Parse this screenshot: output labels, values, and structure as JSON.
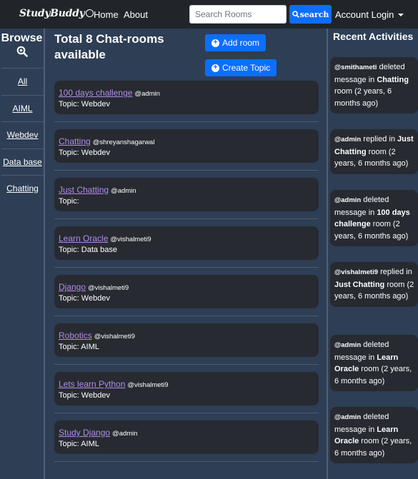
{
  "navbar": {
    "brand": "StudyBuddy",
    "home": "Home",
    "about": "About",
    "search_placeholder": "Search Rooms",
    "search_button": "search",
    "account": "Account Login"
  },
  "browse": {
    "title": "Browse",
    "topics": [
      "All",
      "AIML",
      "Webdev",
      "Data base",
      "Chatting"
    ]
  },
  "main": {
    "title": "Total 8 Chat-rooms available",
    "add_room": "Add room",
    "create_topic": "Create Topic",
    "rooms": [
      {
        "name": "100 days challenge",
        "host": "@admin",
        "topic": "Topic: Webdev"
      },
      {
        "name": "Chatting",
        "host": "@shreyanshagarwal",
        "topic": "Topic: Webdev"
      },
      {
        "name": "Just Chatting",
        "host": "@admin",
        "topic": "Topic:"
      },
      {
        "name": "Learn Oracle",
        "host": "@vishalmeti9",
        "topic": "Topic: Data base"
      },
      {
        "name": "Django",
        "host": "@vishalmeti9",
        "topic": "Topic: Webdev"
      },
      {
        "name": "Robotics",
        "host": "@vishalmeti9",
        "topic": "Topic: AIML"
      },
      {
        "name": "Lets learn Python",
        "host": "@vishalmeti9",
        "topic": "Topic: Webdev"
      },
      {
        "name": "Study Django",
        "host": "@admin",
        "topic": "Topic: AIML"
      }
    ]
  },
  "activities": {
    "title": "Recent Activities",
    "items": [
      {
        "user": "@smithameti",
        "action": " deleted message in ",
        "room": "Chatting",
        "suffix": " room (2 years, 6 months ago)"
      },
      {
        "user": "@admin",
        "action": " replied in ",
        "room": "Just Chatting",
        "suffix": " room (2 years, 6 months ago)"
      },
      {
        "user": "@admin",
        "action": " deleted message in ",
        "room": "100 days challenge",
        "suffix": " room (2 years, 6 months ago)"
      },
      {
        "user": "@vishalmeti9",
        "action": " replied in ",
        "room": "Just Chatting",
        "suffix": " room (2 years, 6 months ago)"
      },
      {
        "user": "@admin",
        "action": " deleted message in ",
        "room": "Learn Oracle",
        "suffix": " room (2 years, 6 months ago)"
      },
      {
        "user": "@admin",
        "action": " deleted message in ",
        "room": "Learn Oracle",
        "suffix": " room (2 years, 6 months ago)"
      }
    ]
  }
}
